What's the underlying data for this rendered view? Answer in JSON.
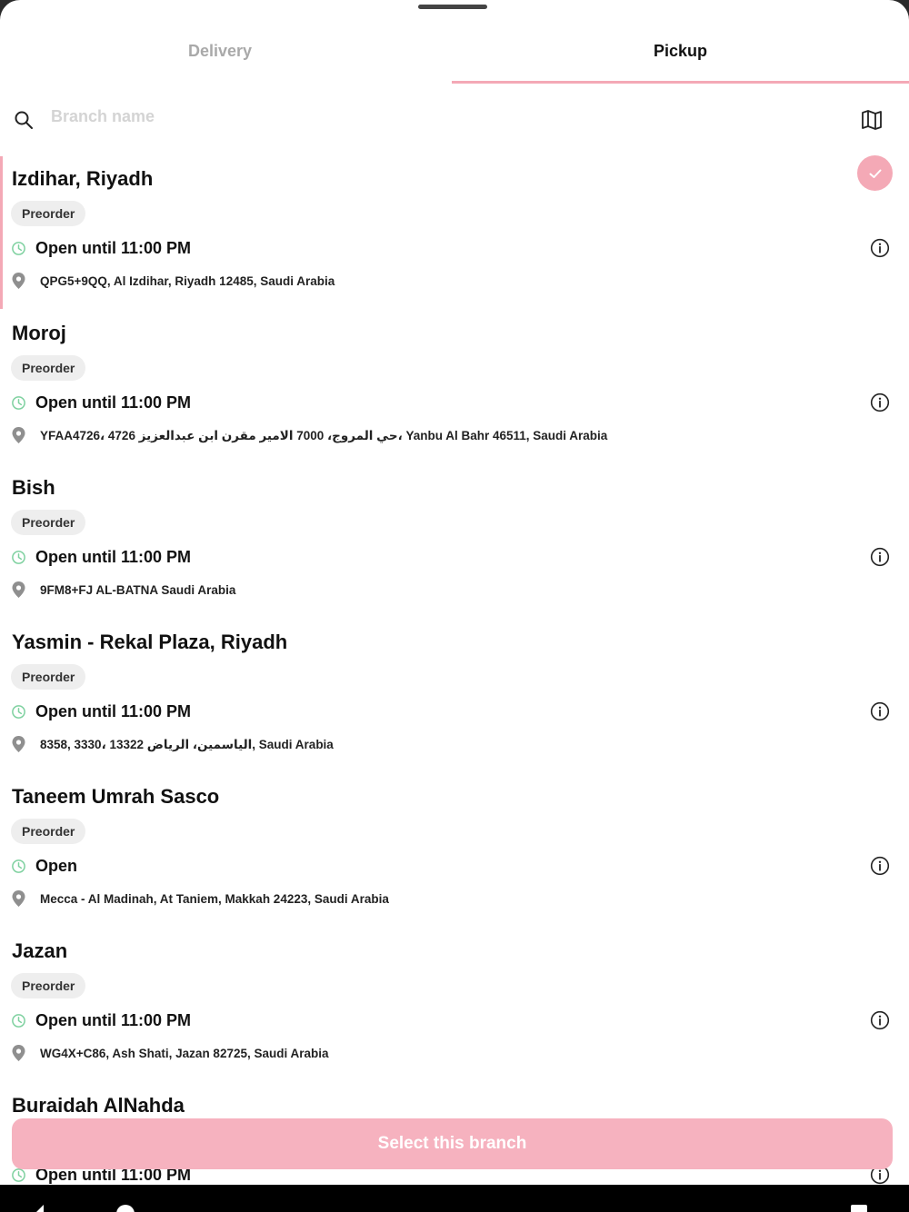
{
  "tabs": [
    {
      "label": "Delivery",
      "active": false
    },
    {
      "label": "Pickup",
      "active": true
    }
  ],
  "search": {
    "placeholder": "Branch name",
    "value": ""
  },
  "colors": {
    "accent": "#f4a9b6",
    "open_green": "#7fd1a0",
    "cta": "#f6b2bf"
  },
  "branches": [
    {
      "name": "Izdihar, Riyadh",
      "badge": "Preorder",
      "hours": "Open until 11:00 PM",
      "address": "QPG5+9QQ, Al Izdihar, Riyadh 12485, Saudi Arabia",
      "selected": true
    },
    {
      "name": "Moroj",
      "badge": "Preorder",
      "hours": "Open until 11:00 PM",
      "address": "YFAA4726، 4726 حي المروج، 7000 الامير مقرن ابن عبدالعزيز، Yanbu Al Bahr 46511, Saudi Arabia",
      "selected": false
    },
    {
      "name": "Bish",
      "badge": "Preorder",
      "hours": "Open until 11:00 PM",
      "address": "9FM8+FJ AL-BATNA Saudi Arabia",
      "selected": false
    },
    {
      "name": "Yasmin - Rekal Plaza, Riyadh",
      "badge": "Preorder",
      "hours": "Open until 11:00 PM",
      "address": "8358, 3330، الياسمين، الرياض 13322, Saudi Arabia",
      "selected": false
    },
    {
      "name": "Taneem Umrah Sasco",
      "badge": "Preorder",
      "hours": "Open",
      "address": "Mecca - Al Madinah, At Taniem, Makkah 24223, Saudi Arabia",
      "selected": false
    },
    {
      "name": "Jazan",
      "badge": "Preorder",
      "hours": "Open until 11:00 PM",
      "address": "WG4X+C86, Ash Shati, Jazan 82725, Saudi Arabia",
      "selected": false
    },
    {
      "name": "Buraidah AlNahda",
      "badge": "",
      "hours": "Open until 11:00 PM",
      "address": "",
      "selected": false
    }
  ],
  "cta": {
    "label": "Select this branch"
  },
  "icons": {
    "search": "search-icon",
    "map": "map-icon",
    "clock": "clock-icon",
    "pin": "location-pin-icon",
    "info": "info-icon",
    "check": "check-icon"
  }
}
